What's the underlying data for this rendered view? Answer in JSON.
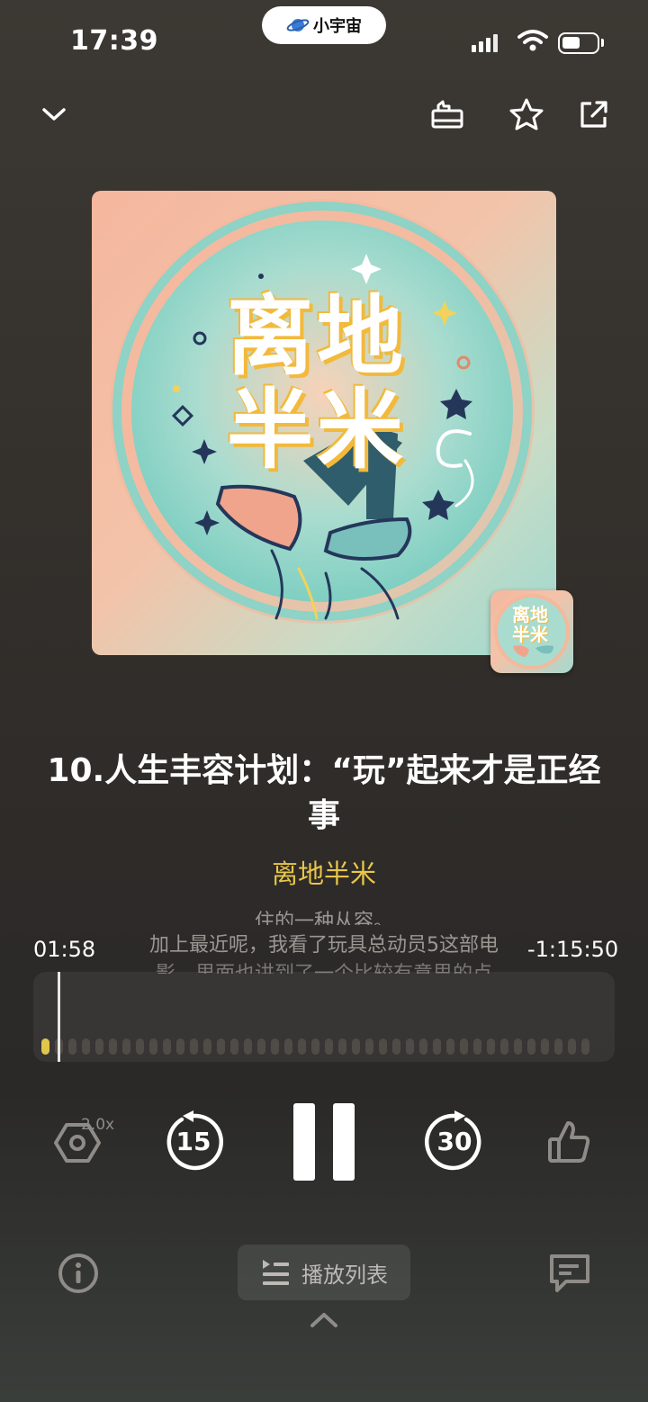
{
  "status_bar": {
    "time": "17:39",
    "island_app": "小宇宙"
  },
  "toolbar": {
    "collapse_icon": "chevron-down-icon",
    "icons": [
      "share-card-icon",
      "star-icon",
      "external-share-icon"
    ]
  },
  "artwork": {
    "title_line1": "离地",
    "title_line2": "半米",
    "thumb_line1": "离地",
    "thumb_line2": "半米"
  },
  "episode": {
    "title": "10.人生丰容计划：“玩”起来才是正经事",
    "podcast": "离地半米"
  },
  "lyrics": {
    "prev": "住的一种从容。",
    "current": "加上最近呢，我看了玩具总动员5这部电",
    "next": "影，里面也讲到了一个比较有意思的点"
  },
  "progress": {
    "elapsed": "01:58",
    "remaining": "-1:15:50",
    "fraction": 0.025
  },
  "controls": {
    "speed": "2.0x",
    "rewind": "15",
    "forward": "30"
  },
  "bottom": {
    "playlist_label": "播放列表"
  },
  "colors": {
    "accent": "#e8c64a",
    "background": "#34302c"
  }
}
